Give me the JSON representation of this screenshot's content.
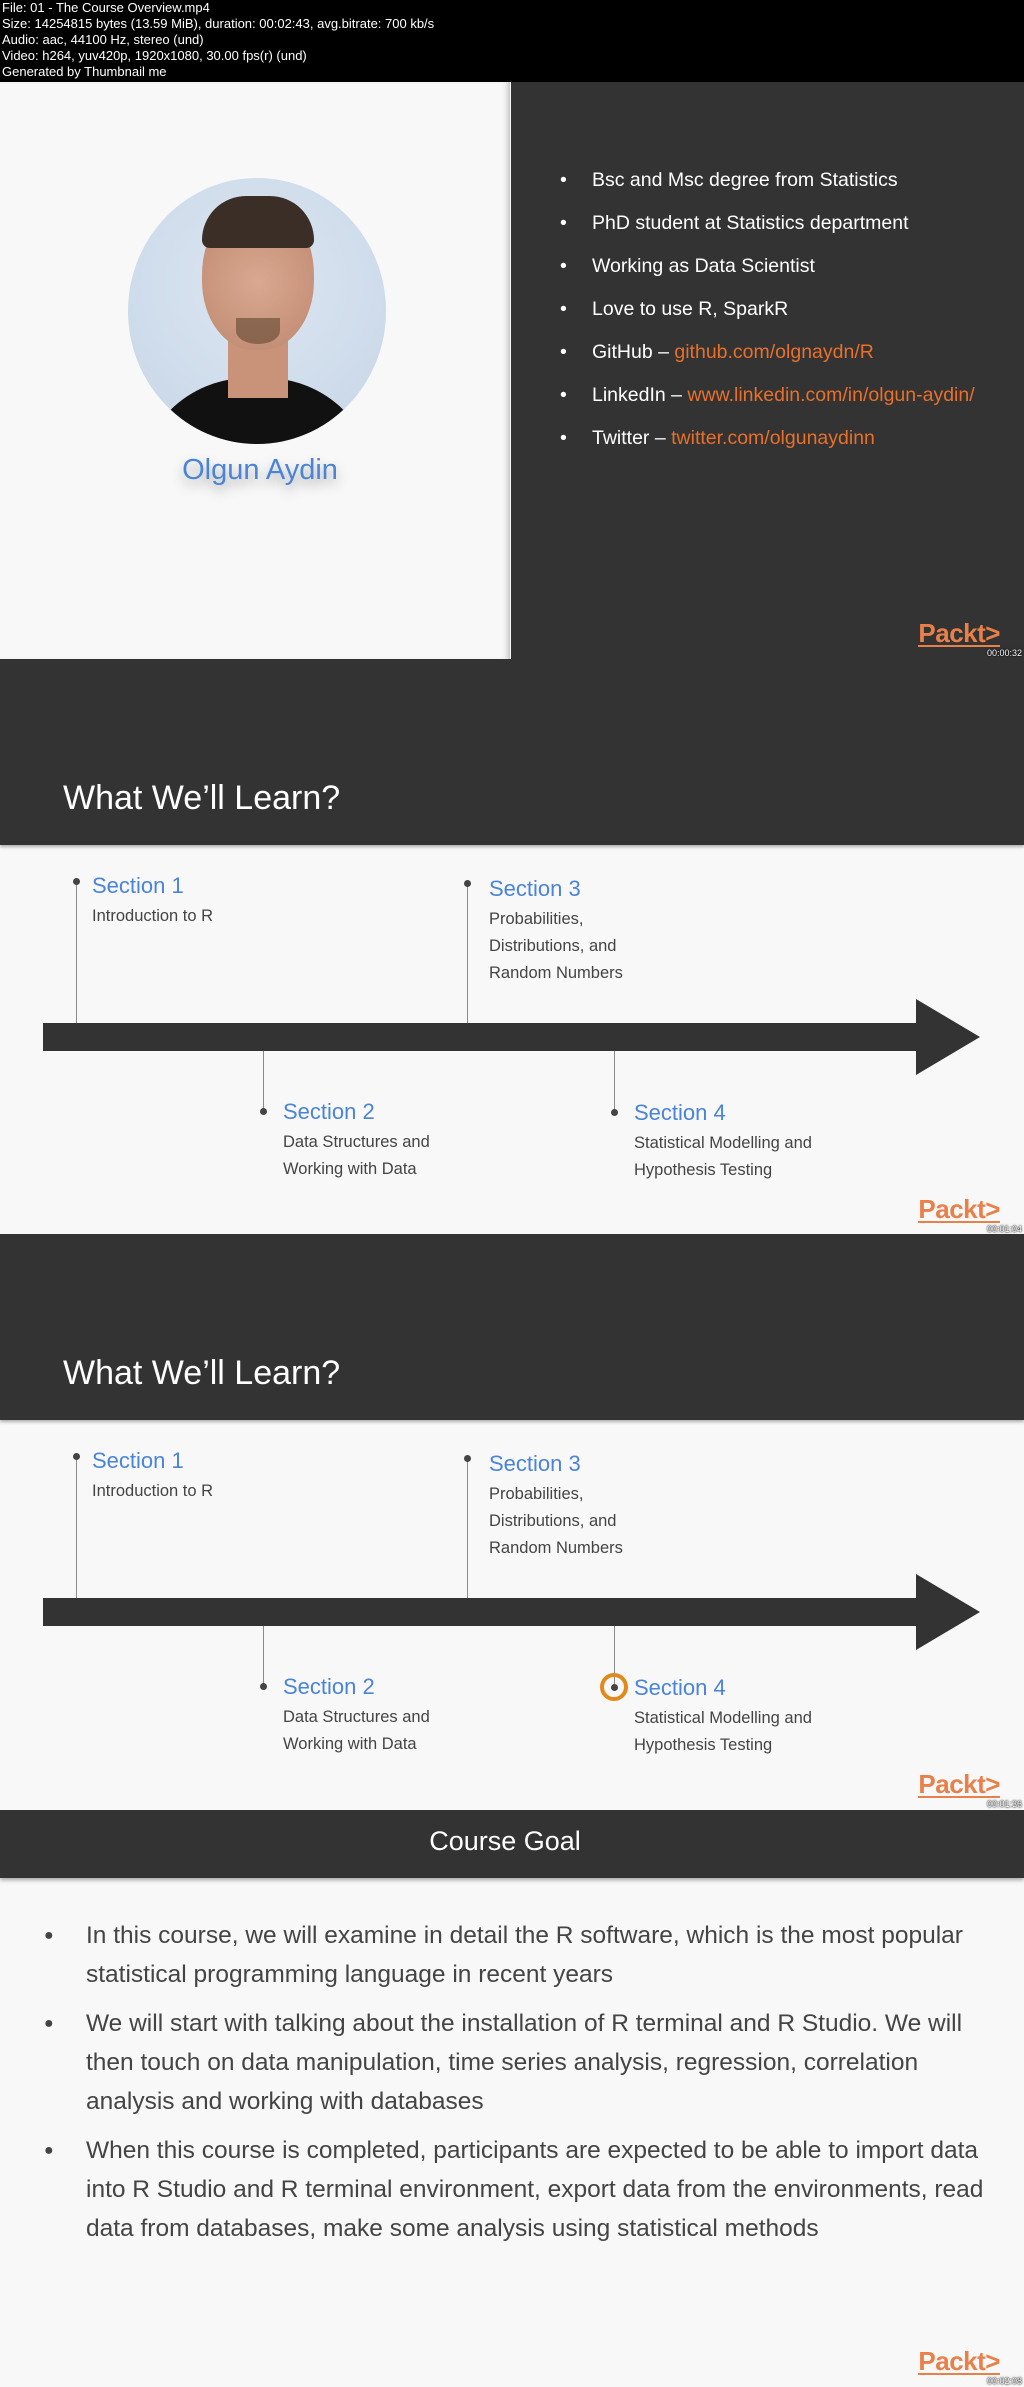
{
  "file_info": {
    "lines": [
      "File: 01 - The Course Overview.mp4",
      "Size: 14254815 bytes (13.59 MiB), duration: 00:02:43, avg.bitrate: 700 kb/s",
      "Audio: aac, 44100 Hz, stereo (und)",
      "Video: h264, yuv420p, 1920x1080, 30.00 fps(r) (und)",
      "Generated by Thumbnail me"
    ]
  },
  "brand": {
    "logo_text": "Packt>",
    "accent_color": "#e8702a",
    "section_title_color": "#4a84d8",
    "highlight_ring_color": "#e08a1c"
  },
  "slides": [
    {
      "type": "instructor",
      "timestamp": "00:00:32",
      "instructor_name": "Olgun Aydin",
      "bio": [
        {
          "text": "Bsc and Msc degree from Statistics",
          "link": ""
        },
        {
          "text": "PhD student at Statistics department",
          "link": ""
        },
        {
          "text": "Working as Data Scientist",
          "link": ""
        },
        {
          "text": "Love to use R, SparkR",
          "link": ""
        },
        {
          "text": "GitHub – ",
          "link": "github.com/olgnaydn/R"
        },
        {
          "text": "LinkedIn – ",
          "link": "www.linkedin.com/in/olgun-aydin/"
        },
        {
          "text": "Twitter – ",
          "link": "twitter.com/olgunaydinn"
        }
      ]
    },
    {
      "type": "timeline",
      "timestamp": "00:01:04",
      "title": "What We’ll Learn?",
      "highlighted_section": null,
      "sections": [
        {
          "title": "Section 1",
          "desc": "Introduction to R"
        },
        {
          "title": "Section 2",
          "desc": "Data Structures and Working with Data"
        },
        {
          "title": "Section 3",
          "desc": "Probabilities, Distributions, and Random Numbers"
        },
        {
          "title": "Section 4",
          "desc": "Statistical Modelling and Hypothesis Testing"
        }
      ]
    },
    {
      "type": "timeline",
      "timestamp": "00:01:36",
      "title": "What We’ll Learn?",
      "highlighted_section": "Section 4",
      "sections": [
        {
          "title": "Section 1",
          "desc": "Introduction to R"
        },
        {
          "title": "Section 2",
          "desc": "Data Structures and Working with Data"
        },
        {
          "title": "Section 3",
          "desc": "Probabilities, Distributions, and Random Numbers"
        },
        {
          "title": "Section 4",
          "desc": "Statistical Modelling and Hypothesis Testing"
        }
      ]
    },
    {
      "type": "bullets",
      "timestamp": "00:02:08",
      "title": "Course Goal",
      "bullets": [
        "In this course, we will examine in detail the R software, which is the most popular statistical programming language in recent years",
        "We will start with talking about the installation of R terminal and R Studio. We will then touch on data manipulation, time series analysis, regression, correlation analysis and working with databases",
        "When this course is completed, participants are expected to be able to import data into R Studio and R terminal environment, export data from the environments, read data from databases, make some analysis using statistical methods"
      ]
    }
  ]
}
